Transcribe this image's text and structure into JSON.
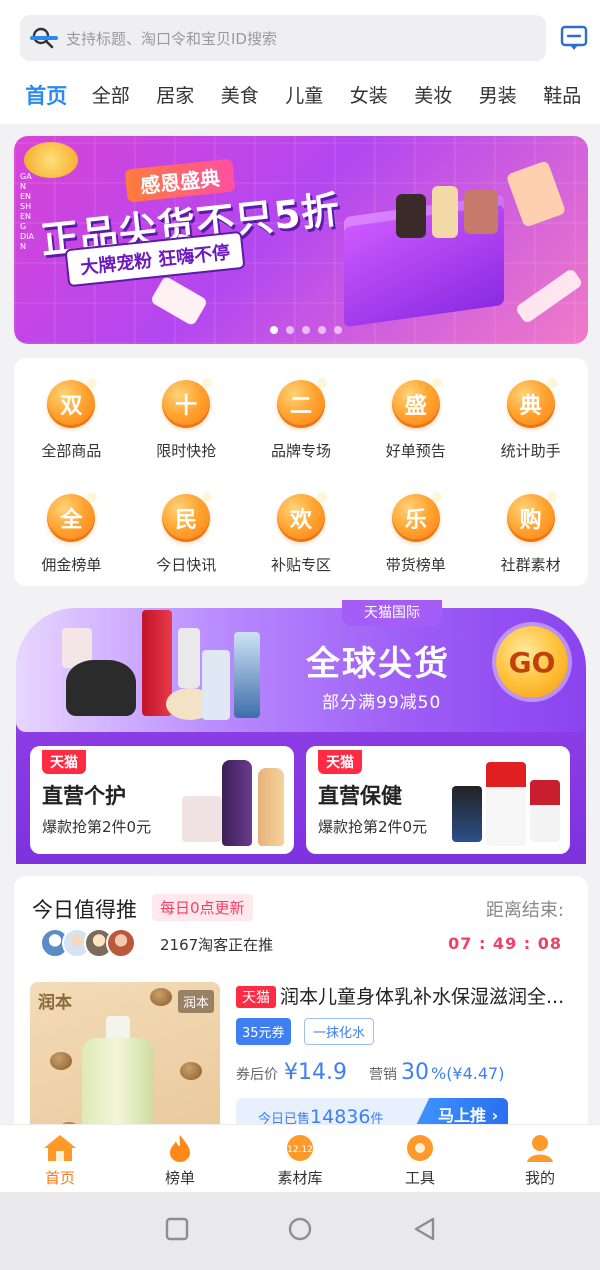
{
  "search": {
    "placeholder": "支持标题、淘口令和宝贝ID搜索"
  },
  "tabs": [
    "首页",
    "全部",
    "居家",
    "美食",
    "儿童",
    "女装",
    "美妆",
    "男装",
    "鞋品"
  ],
  "banner": {
    "small_title": "感恩盛典",
    "big_title": "正品尖货不只5折",
    "subtitle": "大牌宠粉 狂嗨不停",
    "vertical_text": "GAN EN SHENG DIAN",
    "slide_count": 5,
    "active_slide": 1
  },
  "categories": [
    {
      "icon": "双",
      "label": "全部商品"
    },
    {
      "icon": "十",
      "label": "限时快抢"
    },
    {
      "icon": "二",
      "label": "品牌专场"
    },
    {
      "icon": "盛",
      "label": "好单预告"
    },
    {
      "icon": "典",
      "label": "统计助手"
    },
    {
      "icon": "全",
      "label": "佣金榜单"
    },
    {
      "icon": "民",
      "label": "今日快讯"
    },
    {
      "icon": "欢",
      "label": "补贴专区"
    },
    {
      "icon": "乐",
      "label": "带货榜单"
    },
    {
      "icon": "购",
      "label": "社群素材"
    }
  ],
  "tmall_intl": {
    "tag": "天猫国际",
    "title": "全球尖货",
    "subtitle": "部分满99减50",
    "go": "GO",
    "cards": [
      {
        "badge": "天猫",
        "title": "直营个护",
        "sub": "爆款抢第2件0元"
      },
      {
        "badge": "天猫",
        "title": "直营保健",
        "sub": "爆款抢第2件0元"
      }
    ]
  },
  "recommend": {
    "title": "今日值得推",
    "tag": "每日0点更新",
    "end_label": "距离结束:",
    "count_text": "2167淘客正在推",
    "timer": "07 : 49 : 08",
    "product": {
      "brand_tl": "润本",
      "brand_tr": "润本",
      "badge": "天猫",
      "title": "润本儿童身体乳补水保湿滋润全...",
      "coupon": "35元券",
      "feature": "一抹化水",
      "price_label": "券后价",
      "price": "¥14.9",
      "sales_label": "营销",
      "rate": "30",
      "commission": "%(¥4.47)",
      "sold_prefix": "今日已售",
      "sold_num": "14836",
      "sold_suffix": "件",
      "cta": "马上推 ›"
    }
  },
  "bottom_nav": [
    "首页",
    "榜单",
    "素材库",
    "工具",
    "我的"
  ],
  "colors": {
    "accent": "#2b8af1",
    "orange": "#ff7a16",
    "pink": "#f04064"
  }
}
